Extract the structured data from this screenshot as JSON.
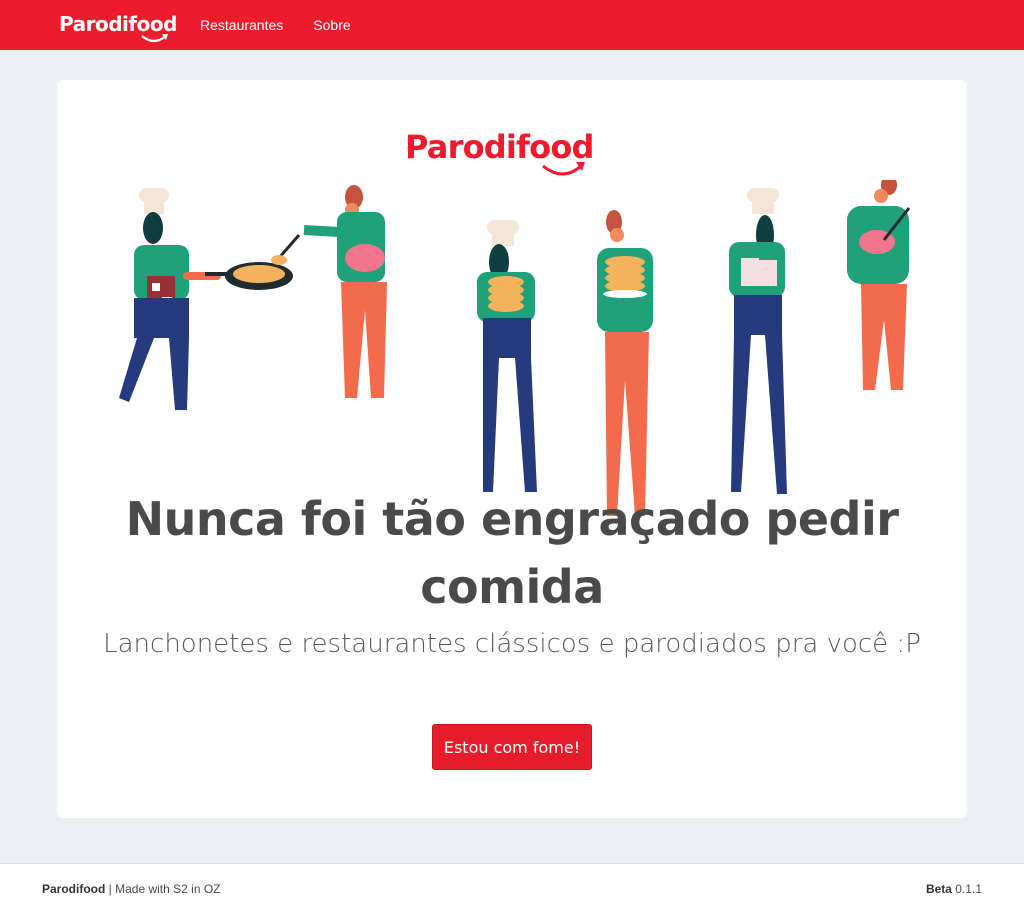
{
  "navbar": {
    "brand": "Parodifood",
    "links": [
      "Restaurantes",
      "Sobre"
    ]
  },
  "hero": {
    "brand": "Parodifood",
    "headline": "Nunca foi tão engraçado pedir comida",
    "subtitle": "Lanchonetes e restaurantes clássicos e parodiados pra você :P",
    "cta_label": "Estou com fome!"
  },
  "footer": {
    "brand": "Parodifood",
    "made_with": "| Made with S2 in OZ",
    "version_label": "Beta",
    "version": "0.1.1"
  },
  "colors": {
    "brand_red": "#ec1c2d",
    "background": "#ebeef3",
    "text": "#4a4a4a"
  }
}
